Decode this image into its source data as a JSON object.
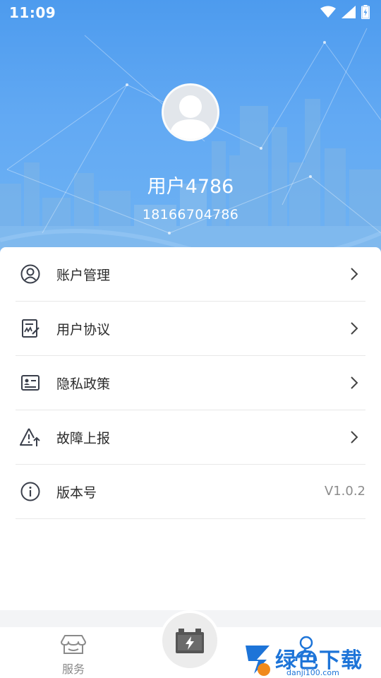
{
  "status_bar": {
    "time": "11:09"
  },
  "profile": {
    "name": "用户4786",
    "phone": "18166704786"
  },
  "menu": [
    {
      "label": "账户管理",
      "icon": "user-circle-icon"
    },
    {
      "label": "用户协议",
      "icon": "document-signature-icon"
    },
    {
      "label": "隐私政策",
      "icon": "id-card-icon"
    },
    {
      "label": "故障上报",
      "icon": "warning-upload-icon"
    },
    {
      "label": "版本号",
      "icon": "info-icon",
      "value": "V1.0.2"
    }
  ],
  "tabbar": {
    "service_label": "服务"
  },
  "watermark": {
    "text": "绿色下载站",
    "url": "danji100.com"
  },
  "colors": {
    "header": "#4d9bee",
    "icon": "#3a3f4b",
    "watermark": "#1d74d8"
  }
}
